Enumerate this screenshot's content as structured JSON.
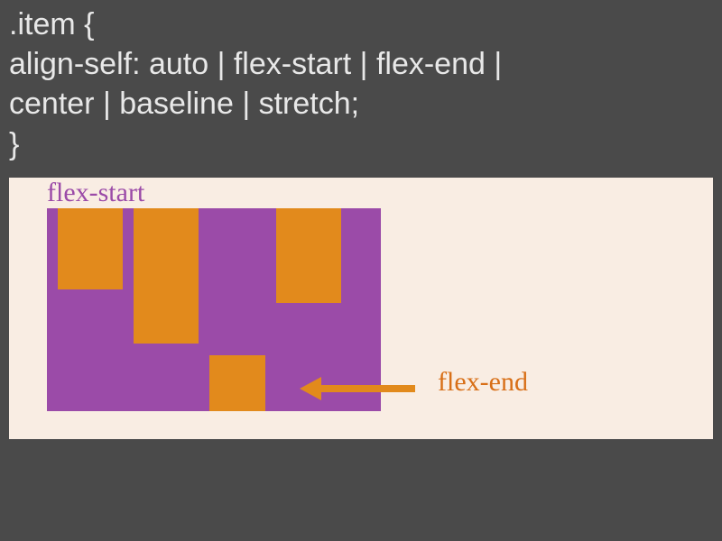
{
  "code": {
    "line1": ".item {",
    "line2": " align-self: auto | flex-start | flex-end |",
    "line3": "center | baseline | stretch;",
    "line4": "}"
  },
  "diagram": {
    "label_top": "flex-start",
    "label_bottom": "flex-end",
    "container_color": "#9b4ba8",
    "item_color": "#e28a1c",
    "items_align": [
      "flex-start",
      "flex-start",
      "flex-end",
      "flex-start"
    ]
  }
}
